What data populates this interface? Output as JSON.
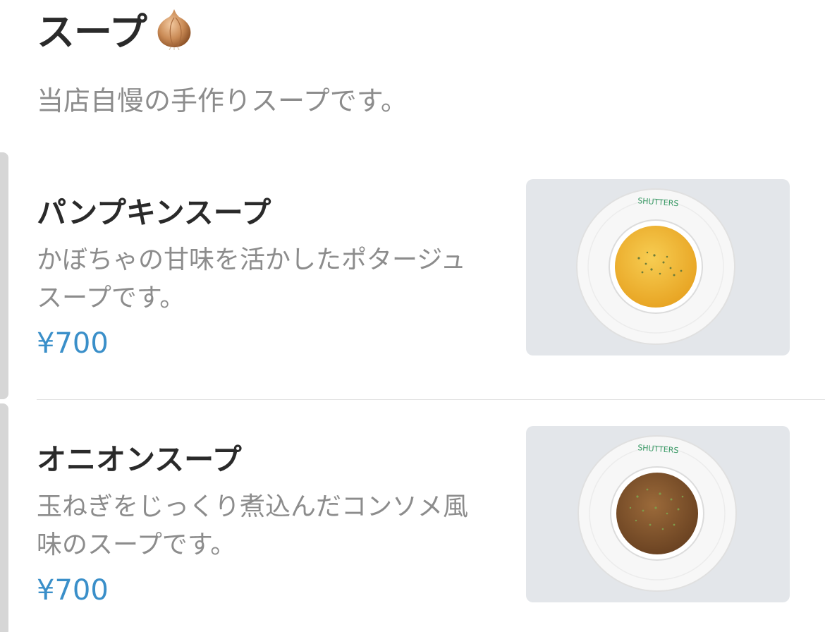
{
  "section": {
    "title": "スープ",
    "emoji_icon": "onion-icon",
    "description": "当店自慢の手作りスープです。"
  },
  "items": [
    {
      "name": "パンプキンスープ",
      "description": "かぼちゃの甘味を活かしたポタージュスープです。",
      "price": "¥700",
      "photo_label": "SHUTTERS",
      "soup_color": "#f1b531"
    },
    {
      "name": "オニオンスープ",
      "description": "玉ねぎをじっくり煮込んだコンソメ風味のスープです。",
      "price": "¥700",
      "photo_label": "SHUTTERS",
      "soup_color": "#8a5a2e"
    }
  ],
  "colors": {
    "price": "#3a8fc9",
    "title": "#2a2a2a",
    "muted_text": "#8c8c8c"
  }
}
